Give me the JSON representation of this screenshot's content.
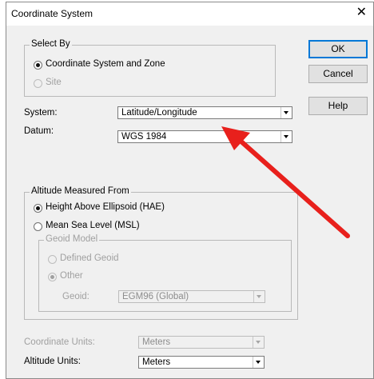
{
  "window": {
    "title": "Coordinate System",
    "close_glyph": "✕"
  },
  "select_by": {
    "legend": "Select By",
    "options": [
      {
        "label": "Coordinate System and Zone",
        "selected": true,
        "enabled": true
      },
      {
        "label": "Site",
        "selected": false,
        "enabled": false
      }
    ]
  },
  "buttons": {
    "ok": "OK",
    "cancel": "Cancel",
    "help": "Help"
  },
  "system": {
    "label": "System:",
    "value": "Latitude/Longitude"
  },
  "datum": {
    "label": "Datum:",
    "value": "WGS 1984"
  },
  "altitude": {
    "legend": "Altitude Measured From",
    "options": [
      {
        "label": "Height Above Ellipsoid (HAE)",
        "selected": true,
        "enabled": true
      },
      {
        "label": "Mean Sea Level (MSL)",
        "selected": false,
        "enabled": true
      }
    ],
    "geoid_model": {
      "legend": "Geoid Model",
      "options": [
        {
          "label": "Defined Geoid",
          "selected": false,
          "enabled": false
        },
        {
          "label": "Other",
          "selected": true,
          "enabled": false
        }
      ],
      "geoid_label": "Geoid:",
      "geoid_value": "EGM96 (Global)"
    }
  },
  "coordinate_units": {
    "label": "Coordinate Units:",
    "value": "Meters",
    "enabled": false
  },
  "altitude_units": {
    "label": "Altitude Units:",
    "value": "Meters",
    "enabled": true
  },
  "annotation": {
    "arrow_color": "#e8201c",
    "icon": "red-arrow-icon"
  }
}
